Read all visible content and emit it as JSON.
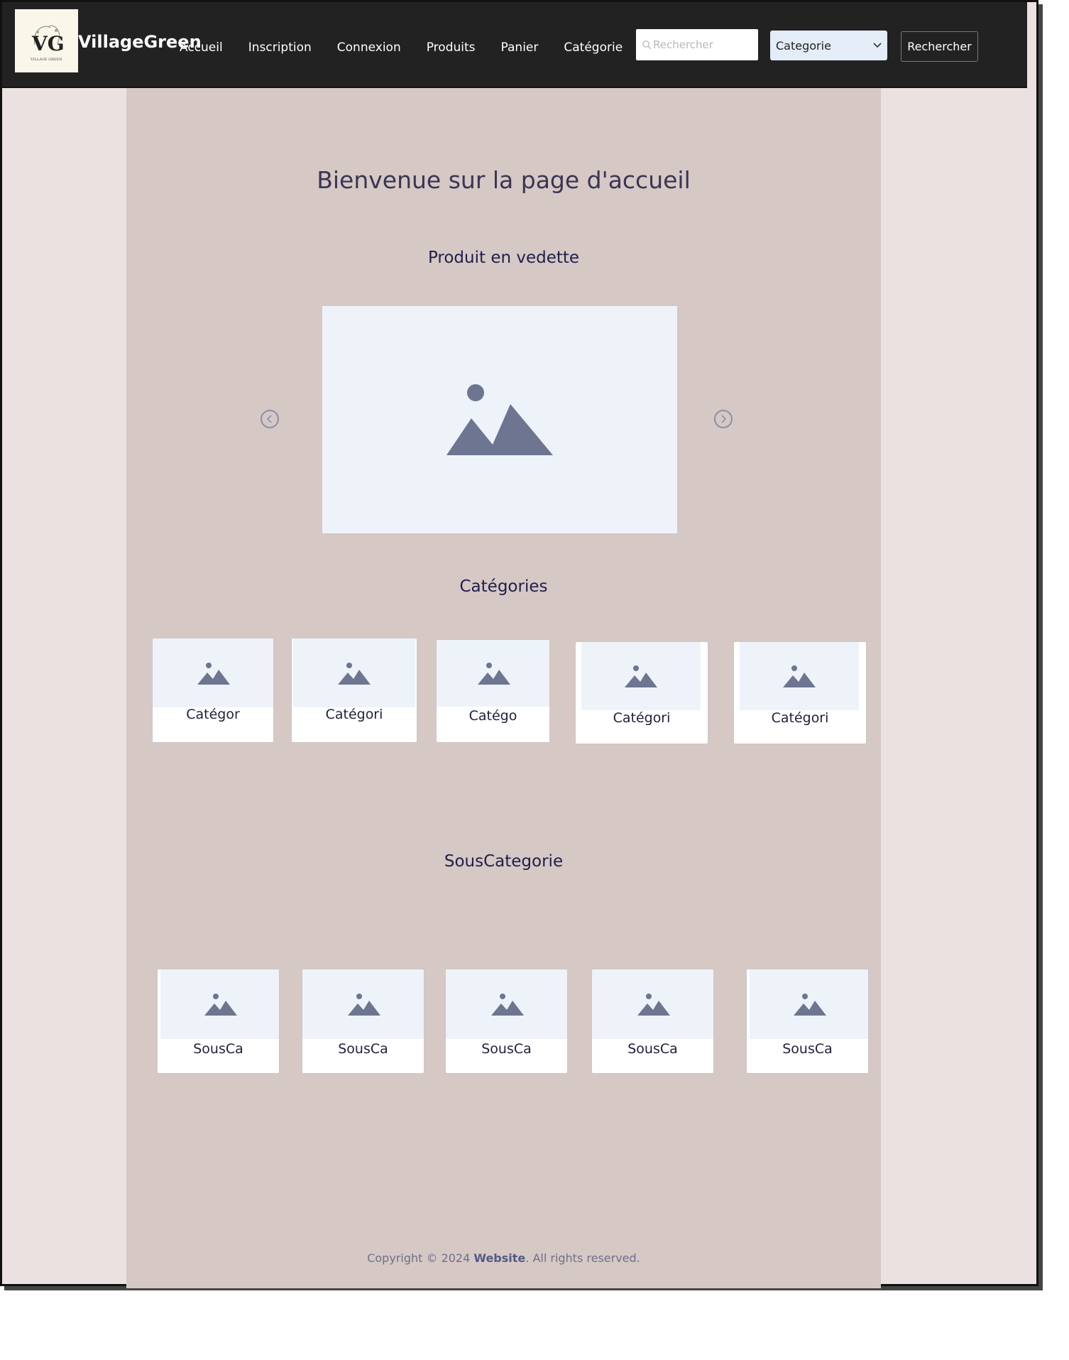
{
  "brand": {
    "name": "VillageGreen",
    "logo_text": "VG",
    "logo_subtext": "VILLAGE GREEN"
  },
  "nav": {
    "links": [
      "Accueil",
      "Inscription",
      "Connexion",
      "Produits",
      "Panier",
      "Catégorie"
    ],
    "search_placeholder": "Rechercher",
    "category_select": "Categorie",
    "search_button": "Rechercher"
  },
  "main": {
    "welcome": "Bienvenue sur la page d'accueil",
    "featured_title": "Produit en vedette",
    "categories_title": "Catégories",
    "subcategories_title": "SousCategorie"
  },
  "categories": [
    "Catégor",
    "Catégori",
    "Catégo",
    "Catégori",
    "Catégori"
  ],
  "subcategories": [
    "SousCa",
    "SousCa",
    "SousCa",
    "SousCa",
    "SousCa"
  ],
  "footer": {
    "prefix": "Copyright © 2024 ",
    "site": "Website",
    "suffix": ". All rights reserved."
  },
  "colors": {
    "navbar": "#222222",
    "page_bg": "#eae1e0",
    "content_bg": "#d6c8c5",
    "placeholder_bg": "#eef3fa",
    "icon": "#6e7590"
  },
  "icons": {
    "image_placeholder": "image-icon",
    "prev": "chevron-left-icon",
    "next": "chevron-right-icon",
    "search": "search-icon",
    "dropdown": "chevron-down-icon"
  }
}
